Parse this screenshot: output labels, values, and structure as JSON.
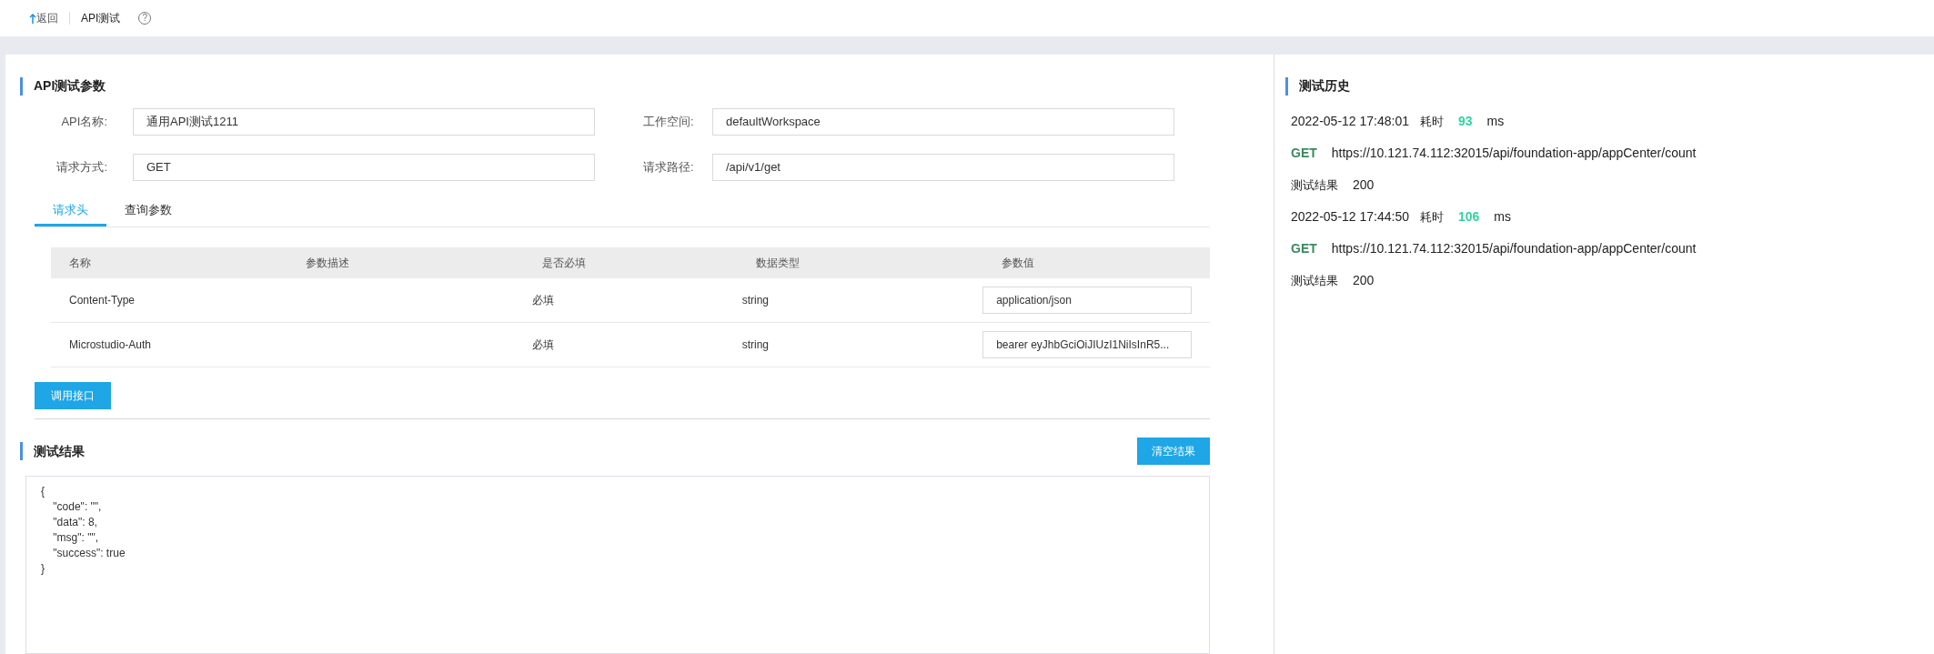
{
  "header": {
    "back": "返回",
    "title": "API测试",
    "help": "?"
  },
  "params": {
    "title": "API测试参数",
    "fields": [
      {
        "label": "API名称:",
        "value": "通用API测试1211"
      },
      {
        "label": "工作空间:",
        "value": "defaultWorkspace"
      },
      {
        "label": "请求方式:",
        "value": "GET"
      },
      {
        "label": "请求路径:",
        "value": "/api/v1/get"
      }
    ],
    "tabs": [
      {
        "label": "请求头",
        "selected": true
      },
      {
        "label": "查询参数",
        "selected": false
      }
    ],
    "table": {
      "columns": [
        "名称",
        "参数描述",
        "是否必填",
        "数据类型",
        "参数值"
      ],
      "rows": [
        {
          "name": "Content-Type",
          "required": "必填",
          "type": "string",
          "value": "application/json"
        },
        {
          "name": "Microstudio-Auth",
          "required": "必填",
          "type": "string",
          "value": "bearer eyJhbGciOiJIUzI1NiIsInR5..."
        }
      ]
    },
    "call_button": "调用接口"
  },
  "result": {
    "title": "测试结果",
    "clear_button": "清空结果",
    "lines": [
      "{",
      "    \"code\": \"\",",
      "    \"data\": 8,",
      "    \"msg\": \"\",",
      "    \"success\": true",
      "}"
    ]
  },
  "history": {
    "title": "测试历史",
    "entries": [
      {
        "time": "2022-05-12 17:48:01",
        "duration_label": "耗时",
        "duration": "93",
        "unit": "ms",
        "method": "GET",
        "url": "https://10.121.74.112:32015/api/foundation-app/appCenter/count",
        "result_label": "测试结果",
        "status": "200"
      },
      {
        "time": "2022-05-12 17:44:50",
        "duration_label": "耗时",
        "duration": "106",
        "unit": "ms",
        "method": "GET",
        "url": "https://10.121.74.112:32015/api/foundation-app/appCenter/count",
        "result_label": "测试结果",
        "status": "200"
      }
    ]
  }
}
